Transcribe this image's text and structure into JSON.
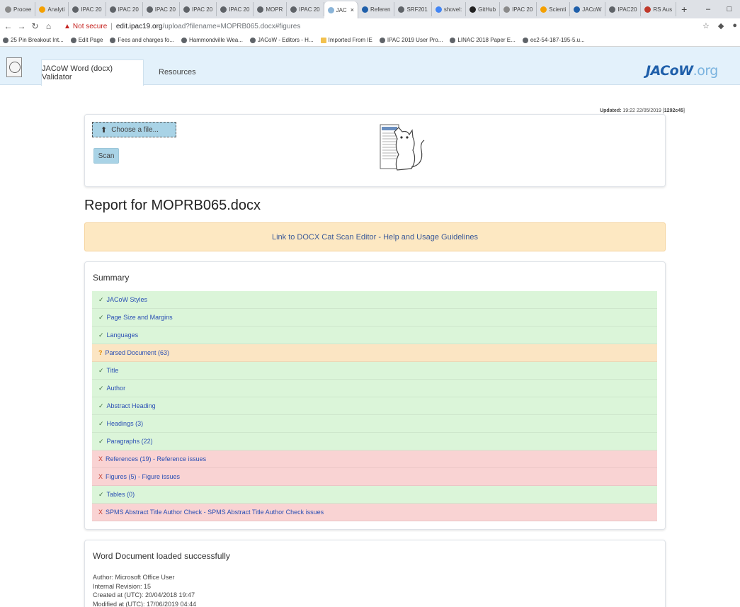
{
  "browser": {
    "tabs": [
      {
        "label": "Procee",
        "color": "#8a8a8a"
      },
      {
        "label": "Analyti",
        "color": "#f4a000"
      },
      {
        "label": "IPAC 20",
        "color": "#5f6368"
      },
      {
        "label": "IPAC 20",
        "color": "#5f6368"
      },
      {
        "label": "IPAC 20",
        "color": "#5f6368"
      },
      {
        "label": "IPAC 20",
        "color": "#5f6368"
      },
      {
        "label": "IPAC 20",
        "color": "#5f6368"
      },
      {
        "label": "MOPR",
        "color": "#5f6368"
      },
      {
        "label": "IPAC 20",
        "color": "#5f6368"
      },
      {
        "label": "JAC",
        "color": "#8ab4d8",
        "active": true
      },
      {
        "label": "Referen",
        "color": "#1f5faa"
      },
      {
        "label": "SRF201",
        "color": "#5f6368"
      },
      {
        "label": "shovel:",
        "color": "#4285f4"
      },
      {
        "label": "GitHub",
        "color": "#222222"
      },
      {
        "label": "IPAC 20",
        "color": "#8a8a8a"
      },
      {
        "label": "Scienti",
        "color": "#f4a000"
      },
      {
        "label": "JACoW",
        "color": "#1f5faa"
      },
      {
        "label": "IPAC20",
        "color": "#5f6368"
      },
      {
        "label": "RS Aus",
        "color": "#c0392b"
      }
    ],
    "new_tab": "+",
    "win_minimize": "–",
    "win_maximize": "□",
    "address": {
      "not_secure": "Not secure",
      "host": "edit.ipac19.org",
      "path": "/upload?filename=MOPRB065.docx#figures"
    },
    "bookmarks": [
      {
        "label": "25 Pin Breakout Int...",
        "folder": false
      },
      {
        "label": "Edit Page",
        "folder": false
      },
      {
        "label": "Fees and charges fo...",
        "folder": false
      },
      {
        "label": "Hammondville Wea...",
        "folder": false
      },
      {
        "label": "JACoW - Editors - H...",
        "folder": false
      },
      {
        "label": "Imported From IE",
        "folder": true
      },
      {
        "label": "IPAC 2019 User Pro...",
        "folder": false
      },
      {
        "label": "LINAC 2018 Paper E...",
        "folder": false
      },
      {
        "label": "ec2-54-187-195-5.u...",
        "folder": false
      }
    ]
  },
  "nav": {
    "brand": "JACoW Word (docx) Validator",
    "resources": "Resources",
    "logo_main": "JACoW",
    "logo_suffix": ".org"
  },
  "updated": {
    "label": "Updated:",
    "value": "19:22 22/05/2019",
    "hash": "1292c45"
  },
  "upload": {
    "choose_label": "Choose a file...",
    "scan_label": "Scan"
  },
  "report": {
    "title": "Report for MOPRB065.docx",
    "guide_link": "Link to DOCX Cat Scan Editor - Help and Usage Guidelines"
  },
  "summary": {
    "title": "Summary",
    "checks": [
      {
        "status": "pass",
        "mark": "✓",
        "label": "JACoW Styles"
      },
      {
        "status": "pass",
        "mark": "✓",
        "label": "Page Size and Margins"
      },
      {
        "status": "pass",
        "mark": "✓",
        "label": "Languages"
      },
      {
        "status": "warn",
        "mark": "?",
        "label": "Parsed Document (63)"
      },
      {
        "status": "pass",
        "mark": "✓",
        "label": "Title"
      },
      {
        "status": "pass",
        "mark": "✓",
        "label": "Author"
      },
      {
        "status": "pass",
        "mark": "✓",
        "label": "Abstract Heading"
      },
      {
        "status": "pass",
        "mark": "✓",
        "label": "Headings (3)"
      },
      {
        "status": "pass",
        "mark": "✓",
        "label": "Paragraphs (22)"
      },
      {
        "status": "fail",
        "mark": "X",
        "label": "References (19) - Reference issues"
      },
      {
        "status": "fail",
        "mark": "X",
        "label": "Figures (5) - Figure issues"
      },
      {
        "status": "pass",
        "mark": "✓",
        "label": "Tables (0)"
      },
      {
        "status": "fail",
        "mark": "X",
        "label": "SPMS Abstract Title Author Check - SPMS Abstract Title Author Check issues"
      }
    ]
  },
  "document": {
    "title": "Word Document loaded successfully",
    "author": "Author: Microsoft Office User",
    "revision": "Internal Revision: 15",
    "created": "Created at (UTC): 20/04/2018 19:47",
    "modified": "Modified at (UTC): 17/06/2019 04:44"
  }
}
